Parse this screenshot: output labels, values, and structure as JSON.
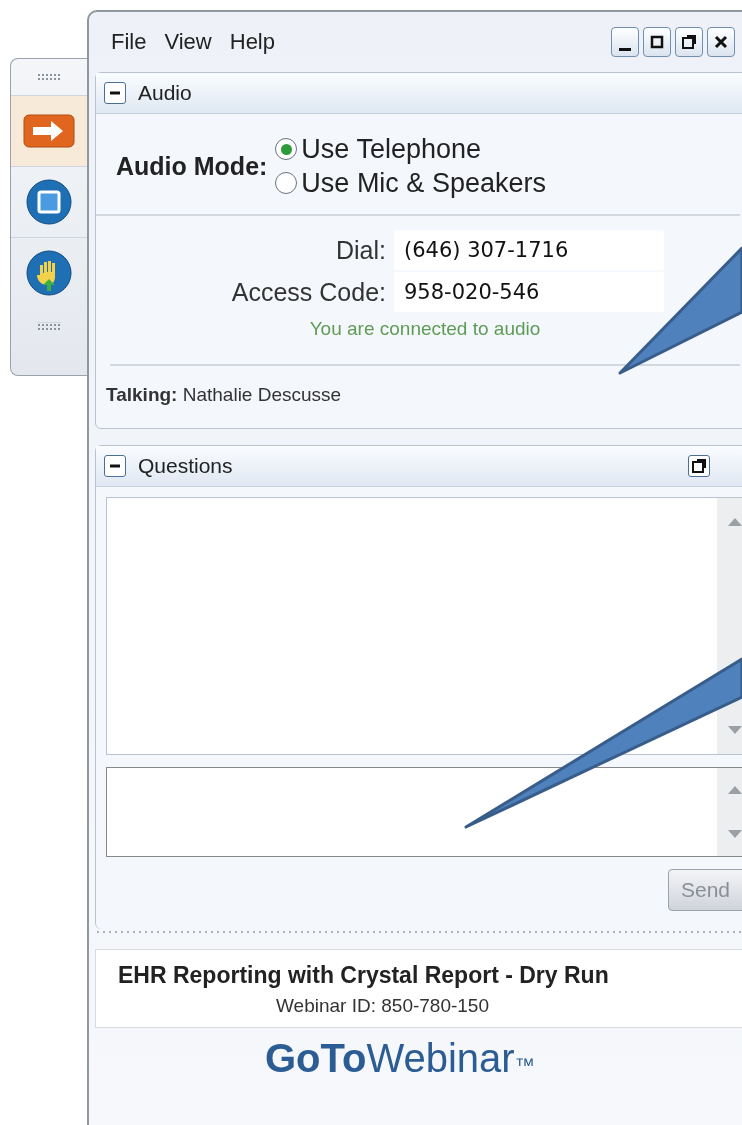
{
  "toolbar": [
    {
      "kind": "arrow",
      "selected": true
    },
    {
      "kind": "square",
      "selected": false
    },
    {
      "kind": "hand",
      "selected": false
    }
  ],
  "menu": [
    "File",
    "View",
    "Help"
  ],
  "audio": {
    "title": "Audio",
    "expanded": true,
    "mode_label": "Audio Mode:",
    "options": [
      {
        "label": "Use Telephone",
        "selected": true
      },
      {
        "label": "Use Mic & Speakers",
        "selected": false
      }
    ],
    "dial_label": "Dial:",
    "dial": "(646) 307-1716",
    "access_label": "Access Code:",
    "access_code": "958-020-546",
    "status": "You are connected to audio",
    "talking": "**Talking:** Nathalie Descusse"
  },
  "questions": {
    "title": "Questions",
    "expanded": true,
    "send": "Send",
    "send_disabled": true
  },
  "webinar": {
    "title": "EHR Reporting with Crystal Report - Dry Run",
    "id": "Webinar ID: 850-780-150"
  },
  "logo": {
    "bold": "GoTo",
    "rest": "Webinar",
    "mark": "™"
  }
}
